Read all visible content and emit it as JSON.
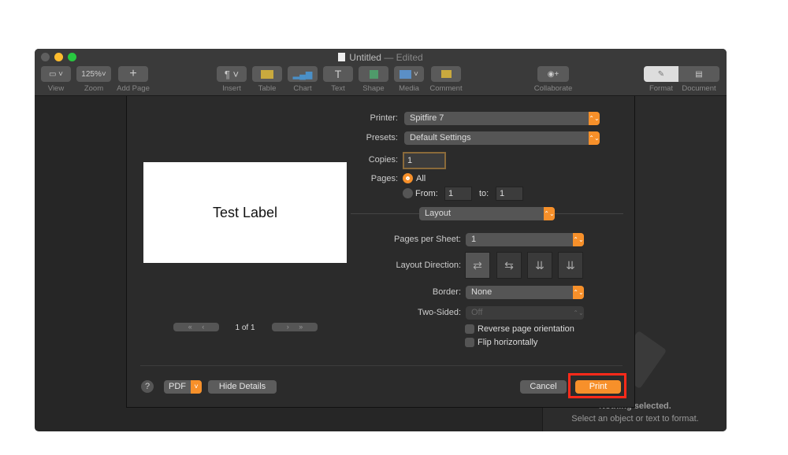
{
  "window": {
    "title": "Untitled",
    "title_suffix": "— Edited"
  },
  "toolbar": {
    "view": "View",
    "zoom": "Zoom",
    "zoom_value": "125%",
    "add_page": "Add Page",
    "insert": "Insert",
    "table": "Table",
    "chart": "Chart",
    "text": "Text",
    "shape": "Shape",
    "media": "Media",
    "comment": "Comment",
    "collaborate": "Collaborate",
    "format": "Format",
    "document": "Document"
  },
  "sidebar": {
    "empty_title": "Nothing selected.",
    "empty_hint": "Select an object or text to format."
  },
  "print": {
    "preview_text": "Test Label",
    "page_indicator": "1 of 1",
    "printer_label": "Printer:",
    "printer": "Spitfire 7",
    "presets_label": "Presets:",
    "presets": "Default Settings",
    "copies_label": "Copies:",
    "copies": "1",
    "pages_label": "Pages:",
    "pages_all": "All",
    "pages_from_label": "From:",
    "pages_from": "1",
    "pages_to_label": "to:",
    "pages_to": "1",
    "section": "Layout",
    "pages_per_sheet_label": "Pages per Sheet:",
    "pages_per_sheet": "1",
    "layout_direction_label": "Layout Direction:",
    "border_label": "Border:",
    "border": "None",
    "two_sided_label": "Two-Sided:",
    "two_sided": "Off",
    "reverse_label": "Reverse page orientation",
    "reverse_checked": false,
    "flip_label": "Flip horizontally",
    "flip_checked": false,
    "help": "?",
    "pdf": "PDF",
    "hide_details": "Hide Details",
    "cancel": "Cancel",
    "print": "Print"
  },
  "colors": {
    "accent": "#f7902a",
    "highlight": "#ff2a1a"
  }
}
